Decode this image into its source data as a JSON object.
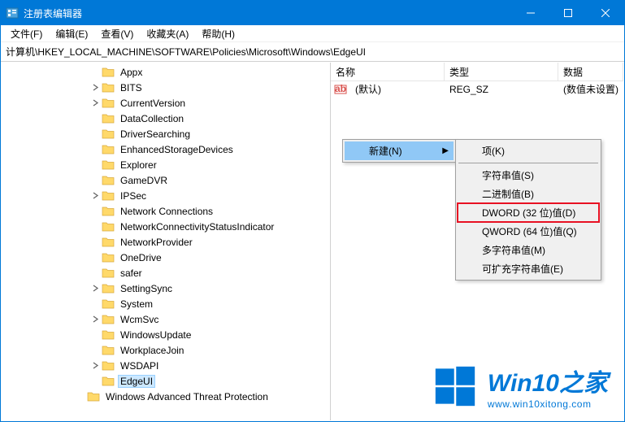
{
  "window": {
    "title": "注册表编辑器"
  },
  "menubar": [
    "文件(F)",
    "编辑(E)",
    "查看(V)",
    "收藏夹(A)",
    "帮助(H)"
  ],
  "addressbar": "计算机\\HKEY_LOCAL_MACHINE\\SOFTWARE\\Policies\\Microsoft\\Windows\\EdgeUI",
  "tree": {
    "items": [
      {
        "depth": 6,
        "exp": "",
        "label": "Appx"
      },
      {
        "depth": 6,
        "exp": "closed",
        "label": "BITS"
      },
      {
        "depth": 6,
        "exp": "closed",
        "label": "CurrentVersion"
      },
      {
        "depth": 6,
        "exp": "",
        "label": "DataCollection"
      },
      {
        "depth": 6,
        "exp": "",
        "label": "DriverSearching"
      },
      {
        "depth": 6,
        "exp": "",
        "label": "EnhancedStorageDevices"
      },
      {
        "depth": 6,
        "exp": "",
        "label": "Explorer"
      },
      {
        "depth": 6,
        "exp": "",
        "label": "GameDVR"
      },
      {
        "depth": 6,
        "exp": "closed",
        "label": "IPSec"
      },
      {
        "depth": 6,
        "exp": "",
        "label": "Network Connections"
      },
      {
        "depth": 6,
        "exp": "",
        "label": "NetworkConnectivityStatusIndicator"
      },
      {
        "depth": 6,
        "exp": "",
        "label": "NetworkProvider"
      },
      {
        "depth": 6,
        "exp": "",
        "label": "OneDrive"
      },
      {
        "depth": 6,
        "exp": "",
        "label": "safer"
      },
      {
        "depth": 6,
        "exp": "closed",
        "label": "SettingSync"
      },
      {
        "depth": 6,
        "exp": "",
        "label": "System"
      },
      {
        "depth": 6,
        "exp": "closed",
        "label": "WcmSvc"
      },
      {
        "depth": 6,
        "exp": "",
        "label": "WindowsUpdate"
      },
      {
        "depth": 6,
        "exp": "",
        "label": "WorkplaceJoin"
      },
      {
        "depth": 6,
        "exp": "closed",
        "label": "WSDAPI"
      },
      {
        "depth": 6,
        "exp": "",
        "label": "EdgeUI",
        "selected": true
      },
      {
        "depth": 5,
        "exp": "",
        "label": "Windows Advanced Threat Protection"
      }
    ]
  },
  "list": {
    "columns": {
      "name": "名称",
      "type": "类型",
      "data": "数据"
    },
    "rows": [
      {
        "name": "(默认)",
        "type": "REG_SZ",
        "data": "(数值未设置)"
      }
    ]
  },
  "context1": {
    "new": "新建(N)"
  },
  "context2": {
    "items": [
      "项(K)",
      "字符串值(S)",
      "二进制值(B)",
      "DWORD (32 位)值(D)",
      "QWORD (64 位)值(Q)",
      "多字符串值(M)",
      "可扩充字符串值(E)"
    ]
  },
  "watermark": {
    "line1": "Win10之家",
    "line2": "www.win10xitong.com"
  }
}
